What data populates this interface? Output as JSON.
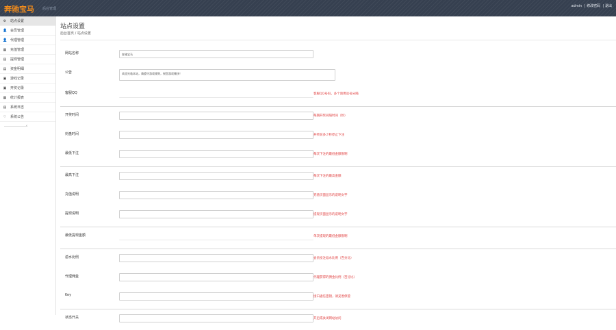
{
  "header": {
    "brand": "奔驰宝马",
    "brand_sub": "后台管理",
    "user": "admin",
    "links": [
      "| 修改密码",
      "| 退出"
    ]
  },
  "sidebar": {
    "items": [
      {
        "icon": "settings-icon",
        "glyph": "⚙",
        "label": "站点设置",
        "active": true
      },
      {
        "icon": "user-icon",
        "glyph": "👤",
        "label": "会员管理",
        "active": false
      },
      {
        "icon": "user-icon",
        "glyph": "👤",
        "label": "代理管理",
        "active": false
      },
      {
        "icon": "table-icon",
        "glyph": "▦",
        "label": "充值管理",
        "active": false
      },
      {
        "icon": "list-icon",
        "glyph": "▤",
        "label": "提现管理",
        "active": false
      },
      {
        "icon": "list-icon",
        "glyph": "▤",
        "label": "资金明细",
        "active": false
      },
      {
        "icon": "file-icon",
        "glyph": "▣",
        "label": "游戏记录",
        "active": false
      },
      {
        "icon": "file-icon",
        "glyph": "▣",
        "label": "开奖记录",
        "active": false
      },
      {
        "icon": "table-icon",
        "glyph": "▦",
        "label": "统计报表",
        "active": false
      },
      {
        "icon": "list-icon",
        "glyph": "▤",
        "label": "系统日志",
        "active": false
      },
      {
        "icon": "heart-icon",
        "glyph": "♡",
        "label": "系统公告",
        "active": false
      }
    ]
  },
  "page": {
    "title": "站点设置",
    "subtitle": "后台首页 / 站点设置"
  },
  "form_rows": [
    {
      "label": "网站名称",
      "value": "奔驰宝马",
      "hint": "",
      "wide": false,
      "plain": false
    },
    {
      "label": "公告",
      "value": "欢迎光临本站，请遵守游戏规则，祝您游戏愉快！",
      "hint": "",
      "wide": true,
      "plain": false
    },
    {
      "label": "客服QQ",
      "value": "",
      "hint": "客服QQ号码，多个请用逗号分隔",
      "wide": false,
      "plain": true
    },
    {
      "sep": true
    },
    {
      "label": "开奖时间",
      "value": "",
      "hint": "每期开奖间隔时间（秒）",
      "wide": false,
      "plain": false
    },
    {
      "label": "封盘时间",
      "value": "",
      "hint": "开奖前多少秒停止下注",
      "wide": false,
      "plain": false
    },
    {
      "label": "最低下注",
      "value": "",
      "hint": "每次下注的最低金额限制",
      "wide": false,
      "plain": false
    },
    {
      "sep": true
    },
    {
      "label": "最高下注",
      "value": "",
      "hint": "每次下注的最高金额",
      "wide": false,
      "plain": false
    },
    {
      "label": "充值说明",
      "value": "",
      "hint": "充值页面显示的说明文字",
      "wide": false,
      "plain": false
    },
    {
      "label": "提现说明",
      "value": "",
      "hint": "提现页面显示的说明文字",
      "wide": false,
      "plain": false
    },
    {
      "sep": true
    },
    {
      "label": "最低提现金额",
      "value": "",
      "hint": "单次提现的最低金额限制",
      "wide": false,
      "plain": true
    },
    {
      "sep": true
    },
    {
      "label": "返水比例",
      "value": "",
      "hint": "会员投注返水比例（百分比）",
      "wide": false,
      "plain": false
    },
    {
      "label": "代理佣金",
      "value": "",
      "hint": "代理获得的佣金比例（百分比）",
      "wide": false,
      "plain": false
    },
    {
      "label": "Key",
      "value": "",
      "hint": "接口通信密钥，请妥善保管",
      "wide": false,
      "plain": false
    },
    {
      "sep": true
    },
    {
      "label": "状态开关",
      "value": "",
      "hint": "开启或关闭网站访问",
      "wide": false,
      "plain": false
    }
  ]
}
